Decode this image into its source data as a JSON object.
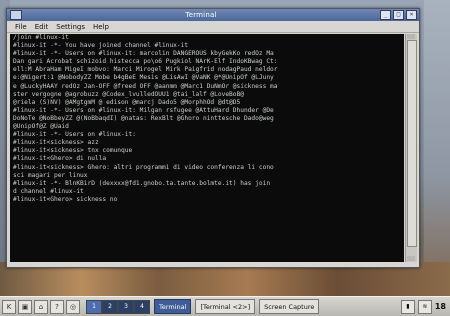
{
  "window": {
    "title": "Terminal",
    "menu": [
      "File",
      "Edit",
      "Settings",
      "Help"
    ]
  },
  "terminal": {
    "lines": [
      "/join #linux-it",
      "#linux-it -*- You have joined channel #linux-it",
      "#linux-it -*- Users on #linux-it: marcolin DANGEROUS kbyGekKo redOz  Ma",
      "Dan gari Acrobat schizoid histecca po\\o6 Pugkiol NArK-Elf IndoKBwag Ct:",
      "ell:M AbraHam MigeI mobvo: Marci Mirogel Mirk Paigfrid nodagPaud neldor",
      "e:@Nigert:1 @NobodyZZ Mobe b4gBeE Mesis @LisAwI @VaNK @*@UnipOf @LJuny",
      "e @LuckyHAAY redOz Jan-OFF @freed OFF @aanmm @Marc1  DuNmOr @sickness ma",
      "ster  vergogne @agrobuzz @Codex_lvulledOUU1 @tai_lalf @LoveBoB@",
      "@riela (S)NV) @AMgtgmM @ edison @marcj Dado5 @MorphhOd @dt@D5",
      "#linux-it -*- Users on #linux-it: Milgan rsfugee @AttuHard Dhunder  @De",
      "DoNoTe @NoBbeyZZ @(NoBbaqdI) @natas: RexBlt @Ghoro ninttesche Dado@weg",
      "@UnipOf@Z @Uaid",
      "#linux-it -*- Users on #linux-it:",
      "#linux-it<sickness> azz",
      "#linux-it<sickness> tnx comunque",
      "#linux-it<Ghero> di nulla",
      "#linux-it<sickness> Ghero: altri programmi di video conferenza li cono",
      "sci magari per linux",
      "#linux-it -*- BlnKBirD (dexxxx@fd1.gnobo.ta.tante.bolmte.it) has join",
      "d channel #linux-it",
      "#linux-it<Ghero> sickness no"
    ]
  },
  "taskbar": {
    "desktops": [
      "1",
      "2",
      "3",
      "4"
    ],
    "active_desktop_index": 0,
    "tasks": [
      {
        "label": "Terminal",
        "active": true
      },
      {
        "label": "[Terminal <2>]",
        "active": false
      },
      {
        "label": "Screen Capture",
        "active": false
      }
    ],
    "clock": "18"
  }
}
